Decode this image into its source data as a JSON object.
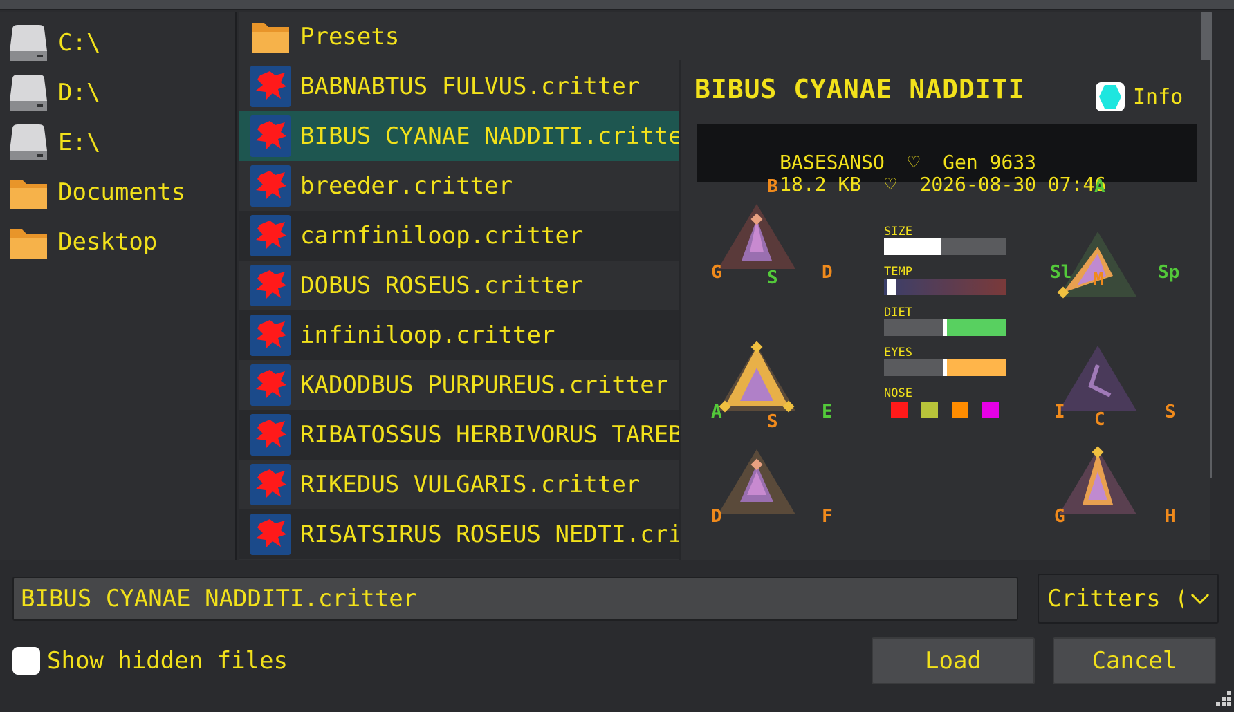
{
  "sidebar": {
    "items": [
      {
        "label": "C:\\",
        "icon": "drive-icon"
      },
      {
        "label": "D:\\",
        "icon": "drive-icon"
      },
      {
        "label": "E:\\",
        "icon": "drive-icon"
      },
      {
        "label": "Documents",
        "icon": "folder-icon"
      },
      {
        "label": "Desktop",
        "icon": "folder-icon"
      }
    ]
  },
  "files": [
    {
      "name": "Presets",
      "kind": "folder"
    },
    {
      "name": "BABNABTUS FULVUS.critter",
      "kind": "critter"
    },
    {
      "name": "BIBUS CYANAE NADDITI.critter",
      "kind": "critter",
      "selected": true
    },
    {
      "name": "breeder.critter",
      "kind": "critter"
    },
    {
      "name": "carnfiniloop.critter",
      "kind": "critter"
    },
    {
      "name": "DOBUS ROSEUS.critter",
      "kind": "critter"
    },
    {
      "name": "infiniloop.critter",
      "kind": "critter"
    },
    {
      "name": "KADODBUS PURPUREUS.critter",
      "kind": "critter"
    },
    {
      "name": "RIBATOSSUS HERBIVORUS TAREBENI.critter",
      "kind": "critter"
    },
    {
      "name": "RIKEDUS VULGARIS.critter",
      "kind": "critter"
    },
    {
      "name": "RISATSIRUS ROSEUS NEDTI.critter",
      "kind": "critter"
    }
  ],
  "info_panel": {
    "title": "BIBUS CYANAE NADDITI",
    "toggle_label": "Info",
    "creator": "BASESANSO",
    "generation": "Gen 9633",
    "size": "18.2 KB",
    "date": "2026-08-30 07:46",
    "heart_symbol": "♡",
    "left_triangles": [
      {
        "top": "B",
        "left": "G",
        "right": "D"
      },
      {
        "top": "S",
        "left": "A",
        "right": "E"
      },
      {
        "top": "S",
        "left": "D",
        "right": "F"
      }
    ],
    "right_triangles": [
      {
        "top": "A",
        "left": "Sl",
        "right": "Sp"
      },
      {
        "top": "M",
        "left": "I",
        "right": "S"
      },
      {
        "top": "C",
        "left": "G",
        "right": "H"
      }
    ],
    "stats": {
      "size_label": "SIZE",
      "size_level": 0.47,
      "temp_label": "TEMP",
      "temp_level": 0.03,
      "diet_label": "DIET",
      "diet_level": 0.5,
      "eyes_label": "EYES",
      "eyes_level": 0.5,
      "nose_label": "NOSE",
      "nose_colors": [
        "#ff1a1a",
        "#b8c43a",
        "#ff8c00",
        "#e600e6"
      ]
    }
  },
  "footer": {
    "filename_value": "BIBUS CYANAE NADDITI.critter",
    "type_select_value": "Critters (",
    "show_hidden_label": "Show hidden files",
    "show_hidden_checked": false,
    "load_label": "Load",
    "cancel_label": "Cancel"
  },
  "colors": {
    "text": "#f2e11b",
    "selected_row": "#1e5650",
    "label_orange": "#f08a1c",
    "label_green": "#53c93a"
  }
}
